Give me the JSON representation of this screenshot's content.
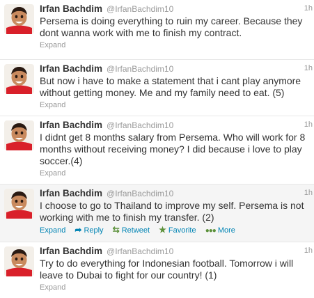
{
  "tweets": [
    {
      "fullname": "Irfan Bachdim",
      "username": "@IrfanBachdim10",
      "time": "1h",
      "text": "Persema is doing everything to ruin my career. Because they dont wanna work with me to finish my contract.",
      "expand": "Expand"
    },
    {
      "fullname": "Irfan Bachdim",
      "username": "@IrfanBachdim10",
      "time": "1h",
      "text": "But now i have to make a statement that i cant play anymore without getting money. Me and my family need to eat. (5)",
      "expand": "Expand"
    },
    {
      "fullname": "Irfan Bachdim",
      "username": "@IrfanBachdim10",
      "time": "1h",
      "text": "I didnt get 8 months salary from Persema. Who will work for 8 months without receiving money? I did because i love to play soccer.(4)",
      "expand": "Expand"
    },
    {
      "fullname": "Irfan Bachdim",
      "username": "@IrfanBachdim10",
      "time": "1h",
      "text": "I choose to go to Thailand to improve my self. Persema is not working with me to finish my transfer. (2)",
      "expand": "Expand",
      "reply": "Reply",
      "retweet": "Retweet",
      "favorite": "Favorite",
      "more": "More"
    },
    {
      "fullname": "Irfan Bachdim",
      "username": "@IrfanBachdim10",
      "time": "1h",
      "text": "Try to do everything for Indonesian football. Tomorrow i will leave to Dubai to fight for our country! (1)",
      "expand": "Expand"
    }
  ],
  "icons": {
    "reply": "reply-icon",
    "retweet": "retweet-icon",
    "favorite": "star-icon",
    "more": "more-dots-icon"
  },
  "colors": {
    "link": "#0084b4",
    "muted": "#999999",
    "action_icon": "#5c913b",
    "hover_bg": "#f5f5f5"
  }
}
